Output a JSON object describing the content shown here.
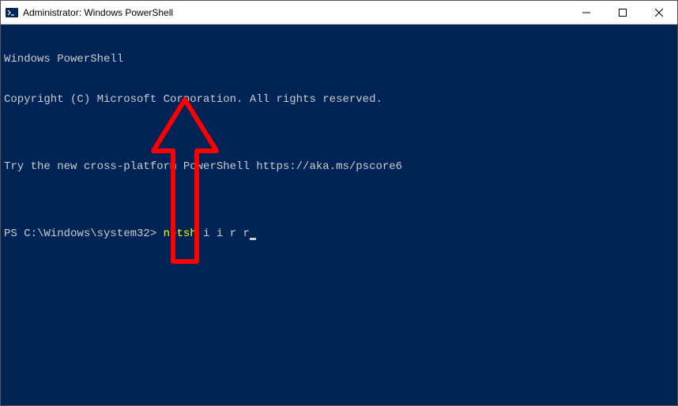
{
  "window": {
    "title": "Administrator: Windows PowerShell"
  },
  "terminal": {
    "line1": "Windows PowerShell",
    "line2": "Copyright (C) Microsoft Corporation. All rights reserved.",
    "line3": "",
    "line4": "Try the new cross-platform PowerShell https://aka.ms/pscore6",
    "line5": "",
    "prompt": "PS C:\\Windows\\system32> ",
    "command_kw": "netsh",
    "command_rest": " i i r r"
  },
  "colors": {
    "terminal_bg": "#012456",
    "terminal_fg": "#cccccc",
    "command_highlight": "#ffff00",
    "annotation": "#ff0000"
  }
}
